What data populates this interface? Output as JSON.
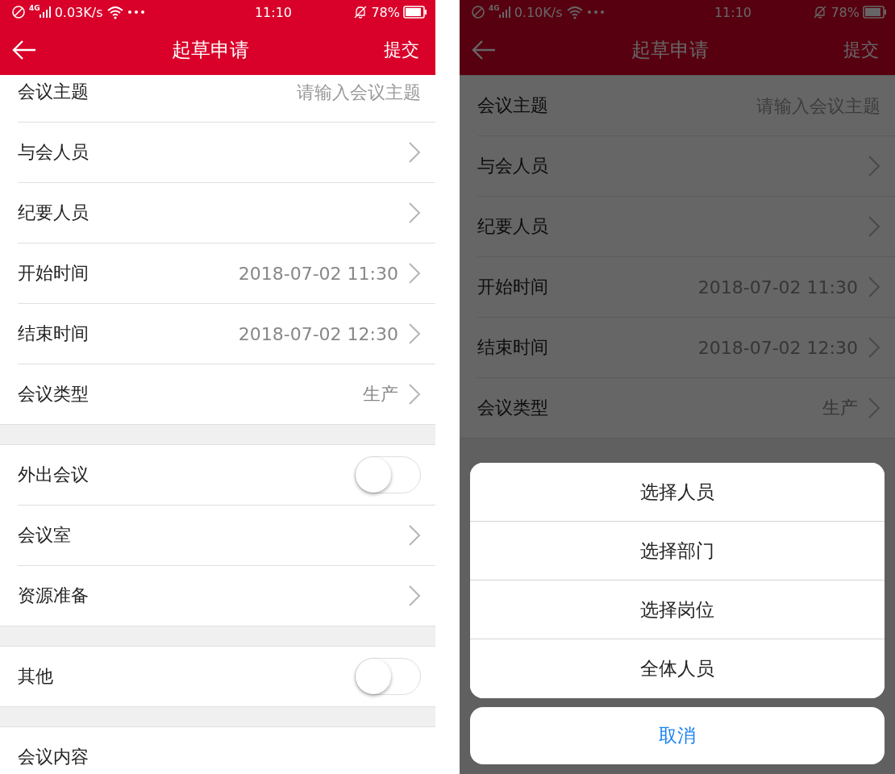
{
  "screens": [
    {
      "dimmed": false,
      "scrolled": true,
      "status_bar": {
        "network": "4G",
        "speed": "0.03K/s",
        "time": "11:10",
        "battery": "78%"
      },
      "nav": {
        "title": "起草申请",
        "action": "提交"
      },
      "sections": [
        {
          "rows": [
            {
              "kind": "input",
              "label": "会议主题",
              "placeholder": "请输入会议主题"
            },
            {
              "kind": "link",
              "label": "与会人员"
            },
            {
              "kind": "link",
              "label": "纪要人员"
            },
            {
              "kind": "link",
              "label": "开始时间",
              "value": "2018-07-02 11:30"
            },
            {
              "kind": "link",
              "label": "结束时间",
              "value": "2018-07-02 12:30"
            },
            {
              "kind": "link",
              "label": "会议类型",
              "value": "生产"
            }
          ]
        },
        {
          "rows": [
            {
              "kind": "toggle",
              "label": "外出会议",
              "on": false
            },
            {
              "kind": "link",
              "label": "会议室"
            },
            {
              "kind": "link",
              "label": "资源准备"
            }
          ]
        },
        {
          "rows": [
            {
              "kind": "toggle",
              "label": "其他",
              "on": false
            }
          ]
        },
        {
          "rows": [
            {
              "kind": "plain",
              "label": "会议内容"
            }
          ]
        }
      ]
    },
    {
      "dimmed": true,
      "scrolled": false,
      "status_bar": {
        "network": "4G",
        "speed": "0.10K/s",
        "time": "11:10",
        "battery": "78%"
      },
      "nav": {
        "title": "起草申请",
        "action": "提交"
      },
      "sections": [
        {
          "rows": [
            {
              "kind": "input",
              "label": "会议主题",
              "placeholder": "请输入会议主题"
            },
            {
              "kind": "link",
              "label": "与会人员"
            },
            {
              "kind": "link",
              "label": "纪要人员"
            },
            {
              "kind": "link",
              "label": "开始时间",
              "value": "2018-07-02 11:30"
            },
            {
              "kind": "link",
              "label": "结束时间",
              "value": "2018-07-02 12:30"
            },
            {
              "kind": "link",
              "label": "会议类型",
              "value": "生产"
            }
          ]
        }
      ],
      "action_sheet": {
        "options": [
          "选择人员",
          "选择部门",
          "选择岗位",
          "全体人员"
        ],
        "cancel": "取消"
      }
    }
  ]
}
